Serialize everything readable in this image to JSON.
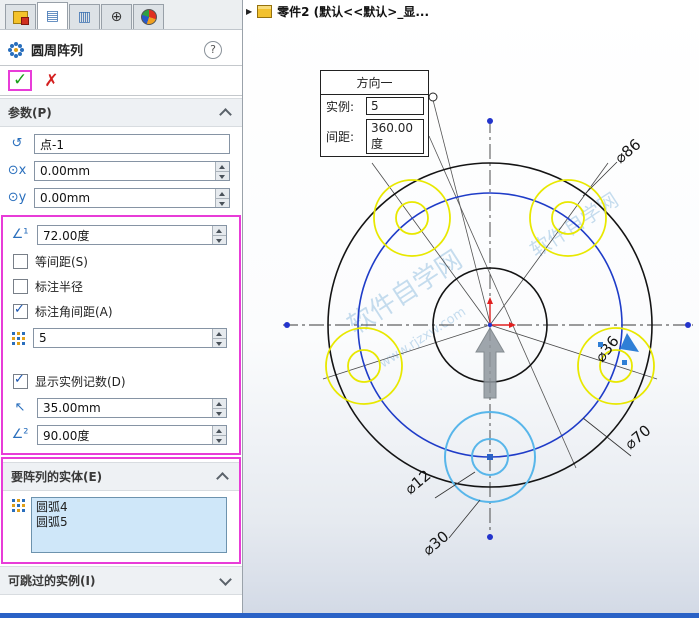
{
  "colors": {
    "highlight": "#e83cd8",
    "yellow": "#e8e800",
    "lightblue": "#58b6ea",
    "blue": "#1f3cc8",
    "accent": "#2a6fbd"
  },
  "icons": {
    "ok": "✓",
    "cancel": "✗",
    "help": "?",
    "breadcrumb_arrow": "▶",
    "tab_properties": "▤",
    "tab_config": "▥",
    "tab_dimxpert": "⊕",
    "reverse": "↺",
    "center_x": "⊙x",
    "center_y": "⊙y",
    "angle1": "∠¹",
    "radius": "↖",
    "angle2": "∠²"
  },
  "header": {
    "breadcrumb": "零件2 (默认<<默认>_显..."
  },
  "panel": {
    "title": "圆周阵列",
    "sections": {
      "params": "参数(P)",
      "entities": "要阵列的实体(E)",
      "skip": "可跳过的实例(I)"
    },
    "fields": {
      "axis": "点-1",
      "center_x": "0.00mm",
      "center_y": "0.00mm",
      "angle": "72.00度",
      "count": "5",
      "radius": "35.00mm",
      "arc_angle": "90.00度"
    },
    "checkboxes": {
      "equal": {
        "label": "等间距(S)",
        "checked": false
      },
      "dim_radius": {
        "label": "标注半径",
        "checked": false
      },
      "dim_angle": {
        "label": "标注角间距(A)",
        "checked": true
      },
      "show_count": {
        "label": "显示实例记数(D)",
        "checked": true
      }
    },
    "entities": {
      "item1": "圆弧4",
      "item2": "圆弧5"
    }
  },
  "callout": {
    "title": "方向一",
    "instances_label": "实例:",
    "instances_value": "5",
    "spacing_label": "间距:",
    "spacing_value": "360.00度"
  },
  "dimensions": {
    "d86": "⌀86",
    "d36": "⌀36",
    "d70": "⌀70",
    "d12": "⌀12",
    "d30": "⌀30"
  },
  "watermark": {
    "line1": "软件自学网",
    "line2": "www.rjzxw.com"
  }
}
